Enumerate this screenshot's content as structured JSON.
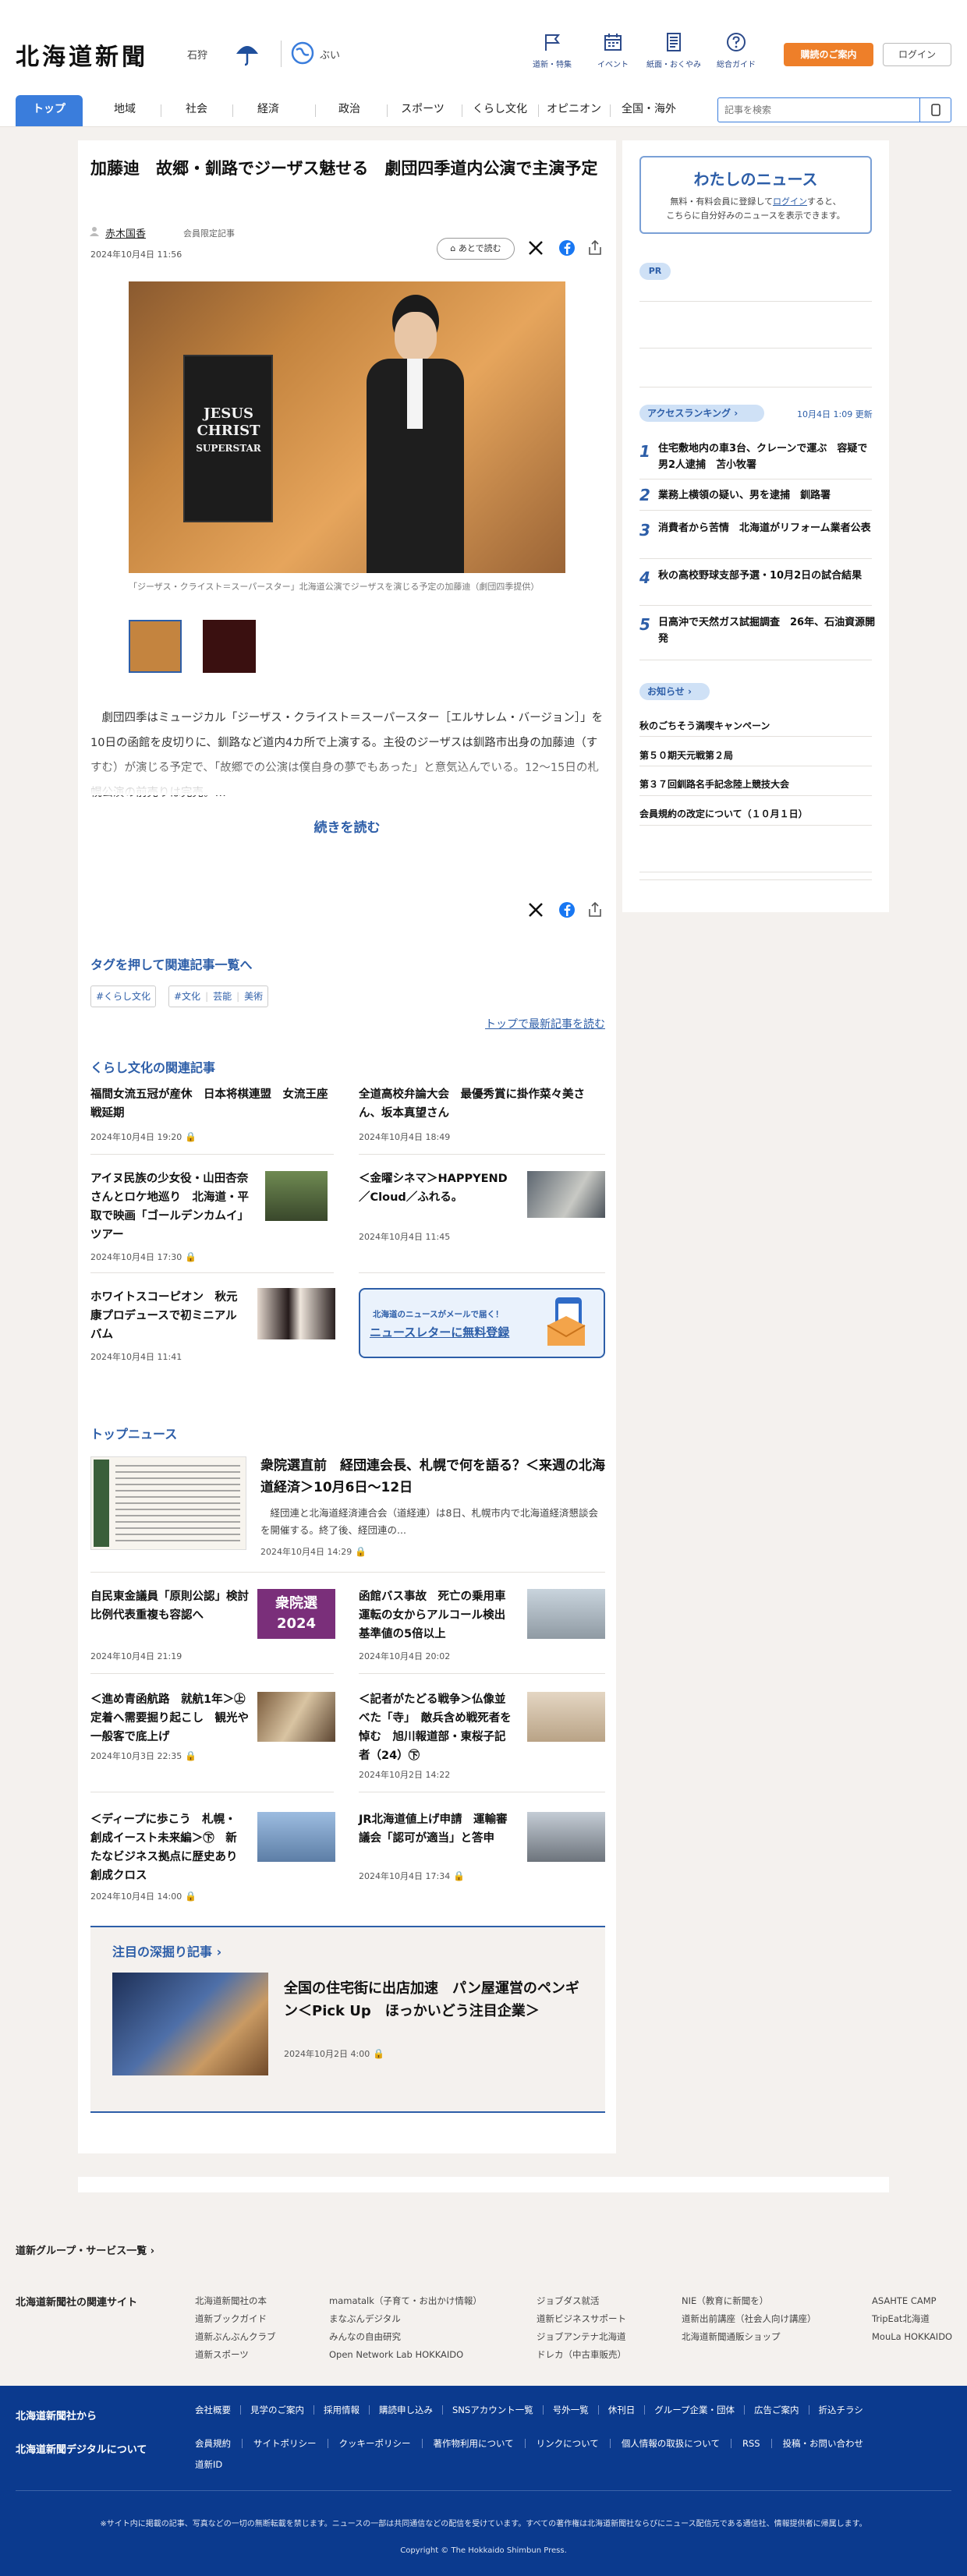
{
  "header": {
    "logo": "北海道新聞",
    "pref": "石狩",
    "weather": "ぶい",
    "nav": [
      "道新・特集",
      "イベント",
      "紙面・おくやみ",
      "総合ガイド"
    ],
    "subscribe": "購読のご案内",
    "login": "ログイン"
  },
  "gnav": {
    "tabs": [
      "トップ",
      "地域",
      "社会",
      "経済",
      "政治",
      "スポーツ",
      "くらし文化",
      "オピニオン",
      "全国・海外"
    ],
    "search_placeholder": "記事を検索"
  },
  "article": {
    "title": "加藤迪　故郷・釧路でジーザス魅せる　劇団四季道内公演で主演予定",
    "author": "赤木国香",
    "member": "会員限定記事",
    "date": "2024年10月4日 11:56",
    "later": "あとで読む",
    "caption": "「ジーザス・クライスト＝スーパースター」北海道公演でジーザスを演じる予定の加藤迪（劇団四季提供）",
    "poster": [
      "JESUS",
      "CHRIST",
      "SUPERSTAR"
    ],
    "body": "　劇団四季はミュージカル「ジーザス・クライスト＝スーパースター［エルサレム・バージョン］」を10日の函館を皮切りに、釧路など道内4カ所で上演する。主役のジーザスは釧路市出身の加藤迪（すすむ）が演じる予定で、「故郷での公演は僕自身の夢でもあった」と意気込んでいる。12～15日の札幌公演の前売りは完売。…",
    "read_more": "続きを読む"
  },
  "tags": {
    "heading": "タグを押して関連記事一覧へ",
    "items": [
      "#くらし文化",
      "#文化",
      "芸能",
      "美術"
    ],
    "top_link": "トップで最新記事を読む"
  },
  "related": {
    "heading": "くらし文化の関連記事",
    "items": [
      {
        "title": "福間女流五冠が産休　日本将棋連盟　女流王座戦延期",
        "date": "2024年10月4日 19:20"
      },
      {
        "title": "全道高校弁論大会　最優秀賞に掛作菜々美さん、坂本真望さん",
        "date": "2024年10月4日 18:49"
      },
      {
        "title": "アイヌ民族の少女役・山田杏奈さんとロケ地巡り　北海道・平取で映画「ゴールデンカムイ」ツアー",
        "date": "2024年10月4日 17:30"
      },
      {
        "title": "＜金曜シネマ＞HAPPYEND／Cloud／ふれる。",
        "date": "2024年10月4日 11:45"
      },
      {
        "title": "ホワイトスコーピオン　秋元康プロデュースで初ミニアルバム",
        "date": "2024年10月4日 11:41"
      }
    ],
    "newsletter": [
      "北海道のニュースがメールで届く！",
      "ニュースレターに無料登録"
    ]
  },
  "top_news": {
    "heading": "トップニュース",
    "lead": {
      "title": "衆院選直前　経団連会長、札幌で何を語る？＜来週の北海道経済＞10月6日～12日",
      "desc": "　経団連と北海道経済連合会（道経連）は8日、札幌市内で北海道経済懇談会を開催する。終了後、経団連の...",
      "date": "2024年10月4日 14:29"
    },
    "items": [
      {
        "title": "自民東金議員「原則公認」検討　比例代表重複も容認へ",
        "date": "2024年10月4日 21:19",
        "img_text": "衆院選 2024"
      },
      {
        "title": "函館バス事故　死亡の乗用車運転の女からアルコール検出　基準値の5倍以上",
        "date": "2024年10月4日 20:02"
      },
      {
        "title": "＜進め青函航路　就航1年＞㊤定着へ需要掘り起こし　観光や一般客で底上げ",
        "date": "2024年10月3日 22:35"
      },
      {
        "title": "＜記者がたどる戦争＞仏像並べた「寺」　敵兵含め戦死者を悼む　旭川報道部・東桜子記者（24）㊦",
        "date": "2024年10月2日 14:22"
      },
      {
        "title": "＜ディープに歩こう　札幌・創成イースト未来編＞㊦　新たなビジネス拠点に歴史あり　創成クロス",
        "date": "2024年10月4日 14:00"
      },
      {
        "title": "JR北海道値上げ申請　運輸審議会「認可が適当」と答申",
        "date": "2024年10月4日 17:34"
      }
    ]
  },
  "deep": {
    "heading": "注目の深掘り記事",
    "title": "全国の住宅街に出店加速　パン屋運営のペンギン＜Pick Up　ほっかいどう注目企業＞",
    "date": "2024年10月2日 4:00"
  },
  "sidebar": {
    "my_title": "わたしのニュース",
    "my_desc1": "無料・有料会員に登録して",
    "my_login": "ログイン",
    "my_desc2": "すると、",
    "my_desc3": "こちらに自分好みのニュースを表示できます。",
    "pr": "PR",
    "ranking_label": "アクセスランキング",
    "ranking_date": "10月4日 1:09 更新",
    "ranking": [
      {
        "n": "1",
        "title": "住宅敷地内の車3台、クレーンで運ぶ　容疑で男2人逮捕　苫小牧署"
      },
      {
        "n": "2",
        "title": "業務上横領の疑い、男を逮捕　釧路署"
      },
      {
        "n": "3",
        "title": "消費者から苦情　北海道がリフォーム業者公表"
      },
      {
        "n": "4",
        "title": "秋の高校野球支部予選・10月2日の試合結果"
      },
      {
        "n": "5",
        "title": "日高沖で天然ガス試掘調査　26年、石油資源開発"
      }
    ],
    "notice_label": "お知らせ",
    "notices": [
      "秋のごちそう満喫キャンペーン",
      "第５０期天元戦第２局",
      "第３７回釧路名手記念陸上競技大会",
      "会員規約の改定について（１０月１日）"
    ]
  },
  "footer": {
    "group": "道新グループ・サービス一覧",
    "related_label": "北海道新聞社の関連サイト",
    "related_cols": [
      [
        "北海道新聞社の本",
        "道新ブックガイド",
        "道新ぶんぶんクラブ",
        "道新スポーツ"
      ],
      [
        "mamatalk（子育て・お出かけ情報）",
        "まなぶんデジタル",
        "みんなの自由研究",
        "Open Network Lab HOKKAIDO"
      ],
      [
        "ジョブダス就活",
        "道新ビジネスサポート",
        "ジョブアンテナ北海道",
        "ドレカ（中古車販売）"
      ],
      [
        "NIE（教育に新聞を）",
        "道新出前講座（社会人向け講座）",
        "北海道新聞通販ショップ"
      ],
      [
        "ASAHTE CAMP",
        "TripEat北海道",
        "MouLa HOKKAIDO"
      ]
    ],
    "from_label": "北海道新聞社から",
    "from_links": [
      "会社概要",
      "見学のご案内",
      "採用情報",
      "購読申し込み",
      "SNSアカウント一覧",
      "号外一覧",
      "休刊日",
      "グループ企業・団体",
      "広告ご案内",
      "折込チラシ"
    ],
    "digital_label": "北海道新聞デジタルについて",
    "digital_links": [
      "会員規約",
      "サイトポリシー",
      "クッキーポリシー",
      "著作物利用について",
      "リンクについて",
      "個人情報の取扱について",
      "RSS",
      "投稿・お問い合わせ"
    ],
    "digital_link2": "道新ID",
    "note": "※サイト内に掲載の記事、写真などの一切の無断転載を禁じます。ニュースの一部は共同通信などの配信を受けています。すべての著作権は北海道新聞社ならびにニュース配信元である通信社、情報提供者に帰属します。",
    "copyright": "Copyright © The Hokkaido Shimbun Press."
  },
  "colors": {
    "brand_blue": "#2d5ea8",
    "tab_blue": "#3a7ddc",
    "orange": "#ee7f29",
    "footer_blue": "#0b3a8e"
  }
}
